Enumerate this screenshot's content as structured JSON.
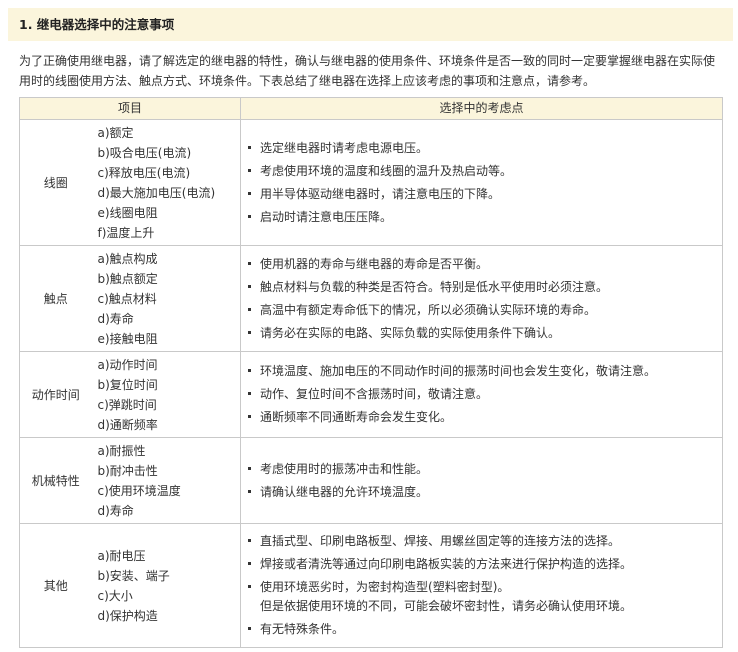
{
  "section_title": "1. 继电器选择中的注意事项",
  "intro": "为了正确使用继电器，请了解选定的继电器的特性，确认与继电器的使用条件、环境条件是否一致的同时一定要掌握继电器在实际使用时的线圈使用方法、触点方式、环境条件。下表总结了继电器在选择上应该考虑的事项和注意点，请参考。",
  "table": {
    "headers": [
      "项目",
      "选择中的考虑点"
    ],
    "rows": [
      {
        "item": "线圈",
        "subs": [
          "a)额定",
          "b)吸合电压(电流)",
          "c)释放电压(电流)",
          "d)最大施加电压(电流)",
          "e)线圈电阻",
          "f)温度上升"
        ],
        "notes": [
          {
            "text": "选定继电器时请考虑电源电压。"
          },
          {
            "text": "考虑使用环境的温度和线圈的温升及热启动等。"
          },
          {
            "text": "用半导体驱动继电器时，请注意电压的下降。"
          },
          {
            "text": "启动时请注意电压压降。"
          }
        ]
      },
      {
        "item": "触点",
        "subs": [
          "a)触点构成",
          "b)触点额定",
          "c)触点材料",
          "d)寿命",
          "e)接触电阻"
        ],
        "notes": [
          {
            "text": "使用机器的寿命与继电器的寿命是否平衡。"
          },
          {
            "text": "触点材料与负载的种类是否符合。特别是低水平使用时必须注意。"
          },
          {
            "text": "高温中有额定寿命低下的情况，所以必须确认实际环境的寿命。"
          },
          {
            "text": "请务必在实际的电路、实际负载的实际使用条件下确认。"
          }
        ]
      },
      {
        "item": "动作时间",
        "subs": [
          "a)动作时间",
          "b)复位时间",
          "c)弹跳时间",
          "d)通断频率"
        ],
        "notes": [
          {
            "text": "环境温度、施加电压的不同动作时间的振荡时间也会发生变化，敬请注意。"
          },
          {
            "text": "动作、复位时间不含振荡时间，敬请注意。"
          },
          {
            "text": "通断频率不同通断寿命会发生变化。"
          }
        ]
      },
      {
        "item": "机械特性",
        "subs": [
          "a)耐振性",
          "b)耐冲击性",
          "c)使用环境温度",
          "d)寿命"
        ],
        "notes": [
          {
            "text": "考虑使用时的振荡冲击和性能。"
          },
          {
            "text": "请确认继电器的允许环境温度。"
          }
        ]
      },
      {
        "item": "其他",
        "subs": [
          "a)耐电压",
          "b)安装、端子",
          "c)大小",
          "d)保护构造"
        ],
        "notes": [
          {
            "text": "直插式型、印刷电路板型、焊接、用螺丝固定等的连接方法的选择。"
          },
          {
            "text": "焊接或者清洗等通过向印刷电路板实装的方法来进行保护构造的选择。"
          },
          {
            "text": "使用环境恶劣时，为密封构造型(塑料密封型)。",
            "cont": "但是依据使用环境的不同，可能会破坏密封性，请务必确认使用环境。"
          },
          {
            "text": "有无特殊条件。"
          }
        ]
      }
    ]
  }
}
